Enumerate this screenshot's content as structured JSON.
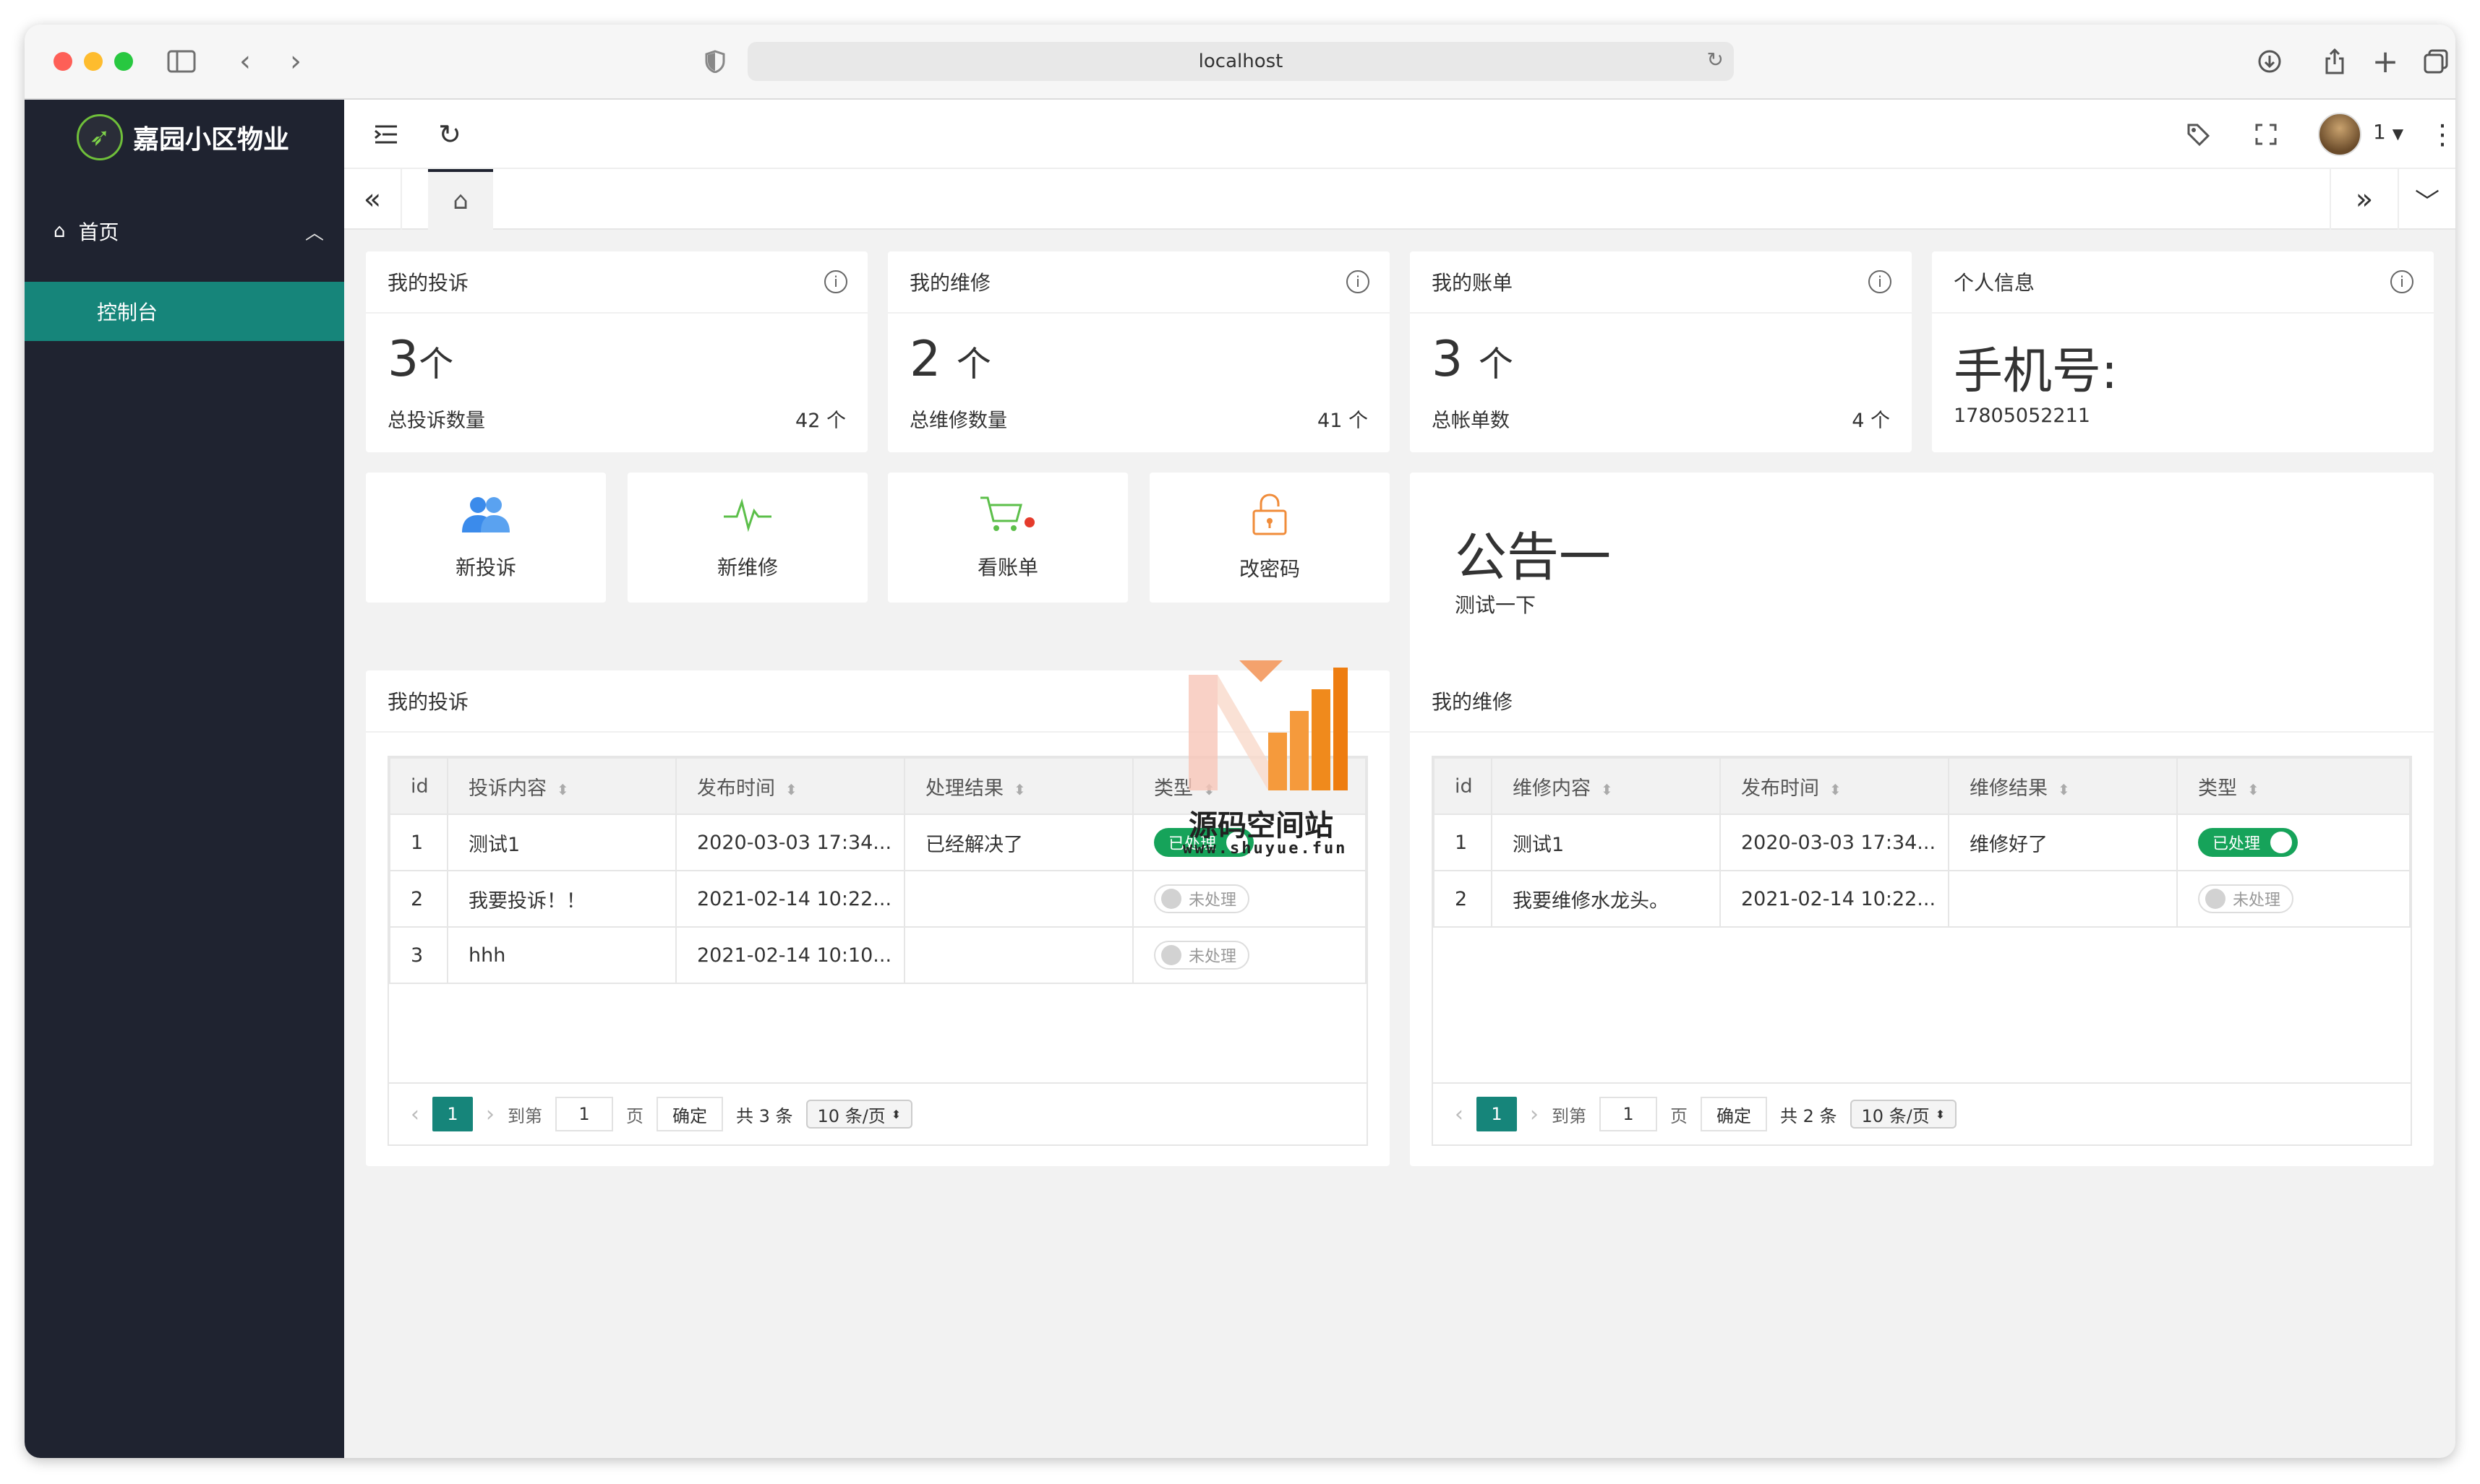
{
  "browser": {
    "url": "localhost"
  },
  "sidebar": {
    "brand": "嘉园小区物业",
    "menu": [
      {
        "label": "首页",
        "expanded": true
      }
    ],
    "submenu": [
      {
        "label": "控制台",
        "active": true
      }
    ]
  },
  "topbar": {
    "user": "1"
  },
  "tabs": {
    "home_icon": "home-icon"
  },
  "stats": [
    {
      "title": "我的投诉",
      "value": "3",
      "unit": "个",
      "label": "总投诉数量",
      "total": "42 个"
    },
    {
      "title": "我的维修",
      "value": "2",
      "unit": "个",
      "label": "总维修数量",
      "total": "41 个"
    },
    {
      "title": "我的账单",
      "value": "3",
      "unit": "个",
      "label": "总帐单数",
      "total": "4 个"
    },
    {
      "title": "个人信息",
      "value": "手机号:",
      "unit": "",
      "label": "17805052211",
      "total": ""
    }
  ],
  "quick": [
    {
      "label": "新投诉",
      "icon": "users-icon",
      "color": "#3b8beb"
    },
    {
      "label": "新维修",
      "icon": "pulse-icon",
      "color": "#5cbf4a"
    },
    {
      "label": "看账单",
      "icon": "cart-icon",
      "color": "#5cbf4a"
    },
    {
      "label": "改密码",
      "icon": "unlock-icon",
      "color": "#f08c3a"
    }
  ],
  "notice": {
    "title": "公告一",
    "body": "测试一下"
  },
  "complaints": {
    "title": "我的投诉",
    "columns": [
      "id",
      "投诉内容",
      "发布时间",
      "处理结果",
      "类型"
    ],
    "rows": [
      {
        "id": "1",
        "content": "测试1",
        "time": "2020-03-03 17:34...",
        "result": "已经解决了",
        "status": "已处理",
        "on": true
      },
      {
        "id": "2",
        "content": "我要投诉！！",
        "time": "2021-02-14 10:22...",
        "result": "",
        "status": "未处理",
        "on": false
      },
      {
        "id": "3",
        "content": "hhh",
        "time": "2021-02-14 10:10...",
        "result": "",
        "status": "未处理",
        "on": false
      }
    ],
    "pager": {
      "current": "1",
      "goto_label": "到第",
      "goto_value": "1",
      "page_label": "页",
      "confirm": "确定",
      "total": "共 3 条",
      "size": "10 条/页"
    }
  },
  "repairs": {
    "title": "我的维修",
    "columns": [
      "id",
      "维修内容",
      "发布时间",
      "维修结果",
      "类型"
    ],
    "rows": [
      {
        "id": "1",
        "content": "测试1",
        "time": "2020-03-03 17:34...",
        "result": "维修好了",
        "status": "已处理",
        "on": true
      },
      {
        "id": "2",
        "content": "我要维修水龙头。",
        "time": "2021-02-14 10:22...",
        "result": "",
        "status": "未处理",
        "on": false
      }
    ],
    "pager": {
      "current": "1",
      "goto_label": "到第",
      "goto_value": "1",
      "page_label": "页",
      "confirm": "确定",
      "total": "共 2 条",
      "size": "10 条/页"
    }
  },
  "watermark": {
    "title": "源码空间站",
    "url": "www.shuyue.fun"
  },
  "colors": {
    "sidebar": "#1f2330",
    "accent": "#16857a",
    "switch_on": "#16a35a"
  }
}
